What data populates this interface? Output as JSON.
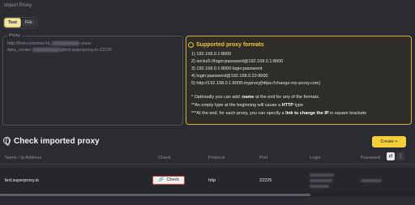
{
  "import": {
    "label": "Import Proxy",
    "modes": [
      {
        "label": "Text",
        "active": true
      },
      {
        "label": "File",
        "active": false
      }
    ]
  },
  "proxy_input": {
    "legend": "Proxy",
    "line1_start": "http://brd-customer-hl_",
    "line1_end": "-zone-",
    "line2_start": "data_center:",
    "line2_end": "@brd.superproxy.io:22225"
  },
  "formats": {
    "title": "Supported proxy formats",
    "lines": [
      "1) 192.168.0.1:8000",
      "2) socks5://login:password@192.168.0.1:8000",
      "3) 192.168.0.1:8000:login:password",
      "4) login:password@192.168.0.22:8000",
      "5) http://192.168.0.1:8000:myproxy[https://change-my-proxy.com]"
    ],
    "note1_pre": "* Optionally you can add ",
    "note1_bold": ":name",
    "note1_post": " at the end for any of the formats.",
    "note2_pre": "**An empty type at the beginning will cause a ",
    "note2_bold": "HTTP",
    "note2_post": " type",
    "note3_pre": "***At the end, for each proxy, you can specify a ",
    "note3_bold": "link to change the IP",
    "note3_post": " in square brackets"
  },
  "check_section": {
    "title": "Check imported proxy",
    "create_label": "Create +"
  },
  "table": {
    "headers": {
      "name": "Name / Ip Address",
      "check": "Check",
      "protocol": "Protocol",
      "port": "Port",
      "login": "Login",
      "password": "Password"
    },
    "rows": [
      {
        "host": "brd.superproxy.io",
        "check_label": "Check",
        "protocol": "http",
        "port": "22225"
      }
    ]
  },
  "colors": {
    "accent": "#f4cf3b",
    "background": "#2b2c31",
    "check_border": "#d23b34"
  }
}
